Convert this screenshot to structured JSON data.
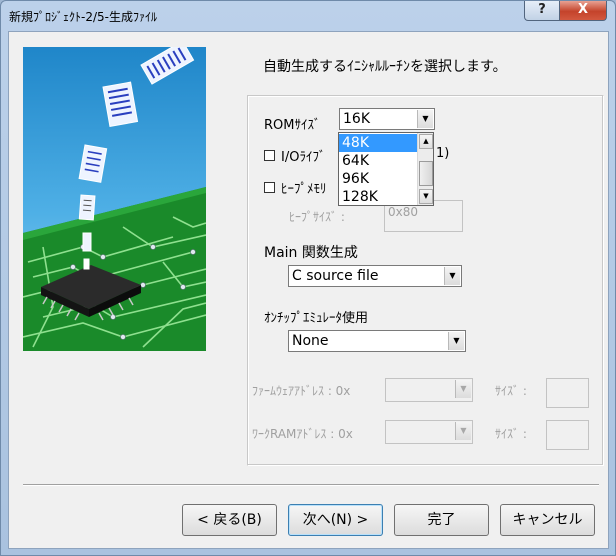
{
  "window": {
    "title": "新規ﾌﾟﾛｼﾞｪｸﾄ-2/5-生成ﾌｧｲﾙ",
    "help_label": "?",
    "close_label": "X"
  },
  "instruction": "自動生成するｲﾆｼｬﾙﾙｰﾁﾝを選択します。",
  "rom": {
    "label": "ROMｻｲｽﾞ",
    "selected": "16K",
    "options": [
      "48K",
      "64K",
      "96K",
      "128K"
    ]
  },
  "io_library": {
    "label": "I/Oﾗｲﾌﾞ",
    "suffix": "1)"
  },
  "heap_memory": {
    "label": "ﾋｰﾌﾟﾒﾓﾘ"
  },
  "heap_size": {
    "label": "ﾋｰﾌﾟｻｲｽﾞ :",
    "value": "0x80"
  },
  "main_func": {
    "label": "Main 関数生成",
    "selected": "C source file"
  },
  "emulator": {
    "label": "ｵﾝﾁｯﾌﾟｴﾐｭﾚｰﾀ使用",
    "selected": "None"
  },
  "firmware": {
    "label": "ﾌｧｰﾑｳｪｱｱﾄﾞﾚｽ : 0x",
    "size_label": "ｻｲｽﾞ :"
  },
  "workram": {
    "label": "ﾜｰｸRAMｱﾄﾞﾚｽ : 0x",
    "size_label": "ｻｲｽﾞ :"
  },
  "buttons": {
    "back": "< 戻る(B)",
    "next": "次へ(N) >",
    "finish": "完了",
    "cancel": "キャンセル"
  },
  "colors": {
    "accent": "#3399ff",
    "pcb": "#1a8a2a",
    "sky": "#1d8fd0"
  }
}
